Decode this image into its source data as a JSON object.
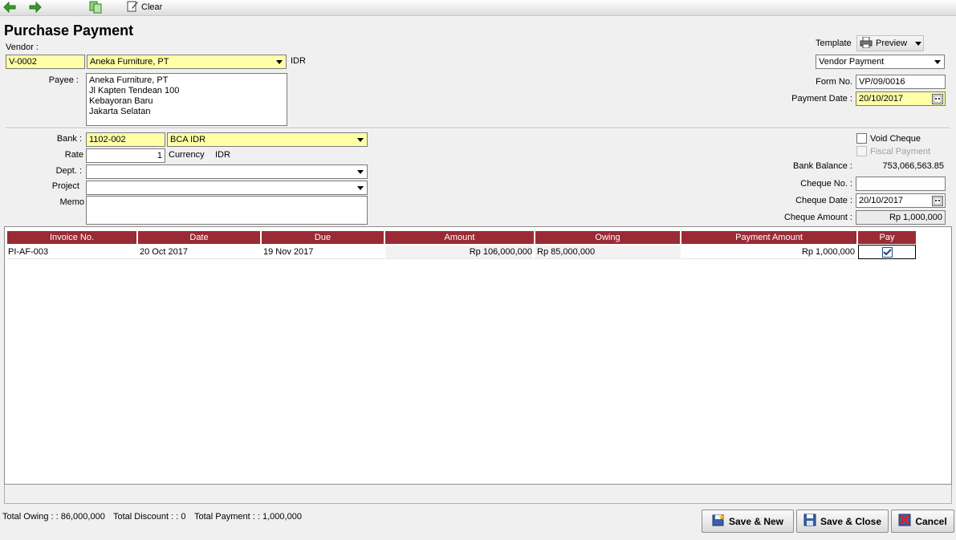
{
  "toolbar": {
    "clear_label": "Clear"
  },
  "page": {
    "title": "Purchase Payment"
  },
  "vendor": {
    "label": "Vendor :",
    "code": "V-0002",
    "name": "Aneka Furniture, PT",
    "currency": "IDR"
  },
  "template": {
    "label": "Template",
    "preview_label": "Preview",
    "value": "Vendor Payment"
  },
  "payee": {
    "label": "Payee :",
    "lines": [
      "Aneka Furniture, PT",
      "Jl Kapten Tendean 100",
      "Kebayoran Baru",
      "Jakarta Selatan"
    ]
  },
  "form": {
    "form_no_label": "Form No.",
    "form_no": "VP/09/0016",
    "payment_date_label": "Payment Date :",
    "payment_date": "20/10/2017"
  },
  "bank": {
    "label": "Bank :",
    "code": "1102-002",
    "name": "BCA IDR",
    "rate_label": "Rate",
    "rate": "1",
    "currency_label": "Currency",
    "currency": "IDR",
    "dept_label": "Dept. :",
    "dept": "",
    "project_label": "Project",
    "project": "",
    "memo_label": "Memo",
    "memo": ""
  },
  "cheque": {
    "void_label": "Void Cheque",
    "fiscal_label": "Fiscal Payment",
    "bank_balance_label": "Bank Balance :",
    "bank_balance": "753,066,563.85",
    "cheque_no_label": "Cheque No. :",
    "cheque_no": "",
    "cheque_date_label": "Cheque Date :",
    "cheque_date": "20/10/2017",
    "cheque_amount_label": "Cheque Amount :",
    "cheque_amount": "Rp 1,000,000"
  },
  "grid": {
    "columns": [
      "Invoice No.",
      "Date",
      "Due",
      "Amount",
      "Owing",
      "Payment Amount",
      "Pay"
    ],
    "rows": [
      {
        "invoice_no": "PI-AF-003",
        "date": "20 Oct 2017",
        "due": "19 Nov 2017",
        "amount": "Rp 106,000,000",
        "owing": "Rp 85,000,000",
        "payment_amount": "Rp 1,000,000",
        "pay": true
      }
    ]
  },
  "footer": {
    "total_owing_label": "Total Owing : :",
    "total_owing": "86,000,000",
    "total_discount_label": "Total Discount : :",
    "total_discount": "0",
    "total_payment_label": "Total Payment : :",
    "total_payment": "1,000,000"
  },
  "buttons": {
    "save_new": "Save & New",
    "save_close": "Save & Close",
    "cancel": "Cancel"
  },
  "colors": {
    "grid_header": "#9a2b35",
    "required_field": "#ffffa8",
    "nav_arrow": "#3a9a2a"
  }
}
